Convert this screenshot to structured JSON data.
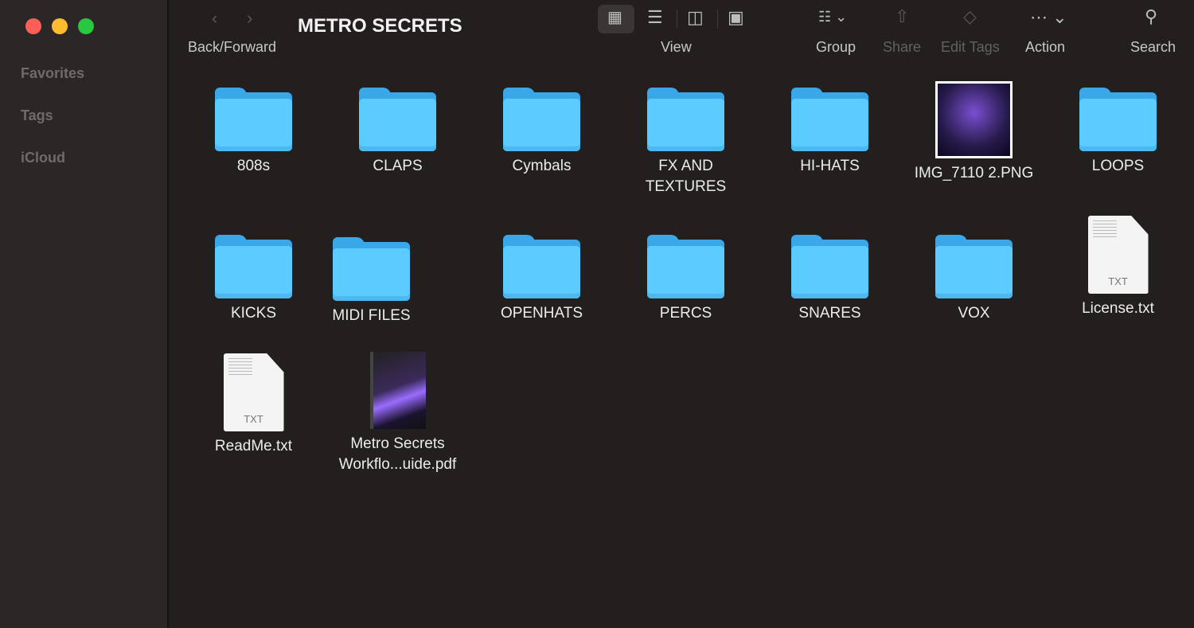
{
  "window": {
    "traffic_lights": {
      "close": "#fe5f57",
      "minimize": "#febc2e",
      "zoom": "#28c840"
    }
  },
  "sidebar": {
    "items": [
      {
        "label": "Favorites"
      },
      {
        "label": "Tags"
      },
      {
        "label": "iCloud"
      }
    ]
  },
  "toolbar": {
    "title": "METRO SECRETS",
    "back_forward": "Back/Forward",
    "view": "View",
    "group": "Group",
    "share": "Share",
    "edit_tags": "Edit Tags",
    "action": "Action",
    "search": "Search",
    "active_view": "icons"
  },
  "files": [
    {
      "name": "808s",
      "kind": "folder"
    },
    {
      "name": "CLAPS",
      "kind": "folder"
    },
    {
      "name": "Cymbals",
      "kind": "folder"
    },
    {
      "name": "FX AND TEXTURES",
      "kind": "folder"
    },
    {
      "name": "HI-HATS",
      "kind": "folder"
    },
    {
      "name": "IMG_7110 2.PNG",
      "kind": "image"
    },
    {
      "name": "LOOPS",
      "kind": "folder"
    },
    {
      "name": "KICKS",
      "kind": "folder"
    },
    {
      "name": "MIDI FILES",
      "kind": "folder"
    },
    {
      "name": "OPENHATS",
      "kind": "folder"
    },
    {
      "name": "PERCS",
      "kind": "folder"
    },
    {
      "name": "SNARES",
      "kind": "folder"
    },
    {
      "name": "VOX",
      "kind": "folder"
    },
    {
      "name": "License.txt",
      "kind": "txt",
      "badge": "TXT"
    },
    {
      "name": "ReadMe.txt",
      "kind": "txt",
      "badge": "TXT"
    },
    {
      "name": "Metro Secrets Workflo...uide.pdf",
      "kind": "pdf"
    }
  ],
  "accent": "#5ccbff"
}
